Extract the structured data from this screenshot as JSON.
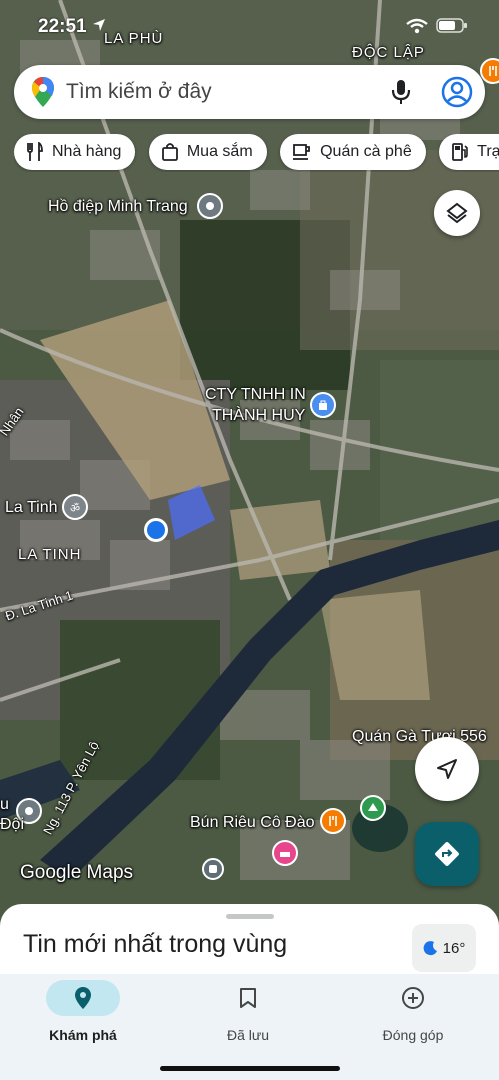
{
  "status": {
    "time": "22:51"
  },
  "search": {
    "placeholder": "Tìm kiếm ở đây"
  },
  "chips": [
    {
      "label": "Nhà hàng",
      "icon": "fork-knife-icon"
    },
    {
      "label": "Mua sắm",
      "icon": "shopping-bag-icon"
    },
    {
      "label": "Quán cà phê",
      "icon": "coffee-cup-icon"
    },
    {
      "label": "Trạm",
      "icon": "gas-station-icon"
    }
  ],
  "map_labels": {
    "la_phu": "LA PHÙ",
    "doc_lap": "ĐỘC LẬP",
    "ho_diep": "Hồ điệp Minh Trang",
    "cty_line1": "CTY TNHH IN",
    "cty_line2": "THÀNH HUY",
    "la_tinh_poi": "La Tinh",
    "la_tinh_area": "LA TINH",
    "nhan": "Nhân",
    "road_la_tinh": "Đ. La Tinh 1",
    "road_yen_lo": "Ng. 113 P. Yên Lộ",
    "quan_ga": "Quán Gà Tươi 556",
    "bun_rieu": "Bún Riêu Cô Đào",
    "doi": "Đội",
    "u": "u"
  },
  "watermark": "Google Maps",
  "sheet": {
    "title": "Tin mới nhất trong vùng",
    "temperature": "16°"
  },
  "nav": [
    {
      "label": "Khám phá",
      "active": true
    },
    {
      "label": "Đã lưu",
      "active": false
    },
    {
      "label": "Đóng góp",
      "active": false
    }
  ],
  "colors": {
    "accent": "#0b5f6b",
    "nav_pill": "#c2e7f0",
    "blue_dot": "#1a73e8",
    "food_poi": "#f57c00",
    "hotel_poi": "#e8468c",
    "park_poi": "#2e9a50"
  }
}
